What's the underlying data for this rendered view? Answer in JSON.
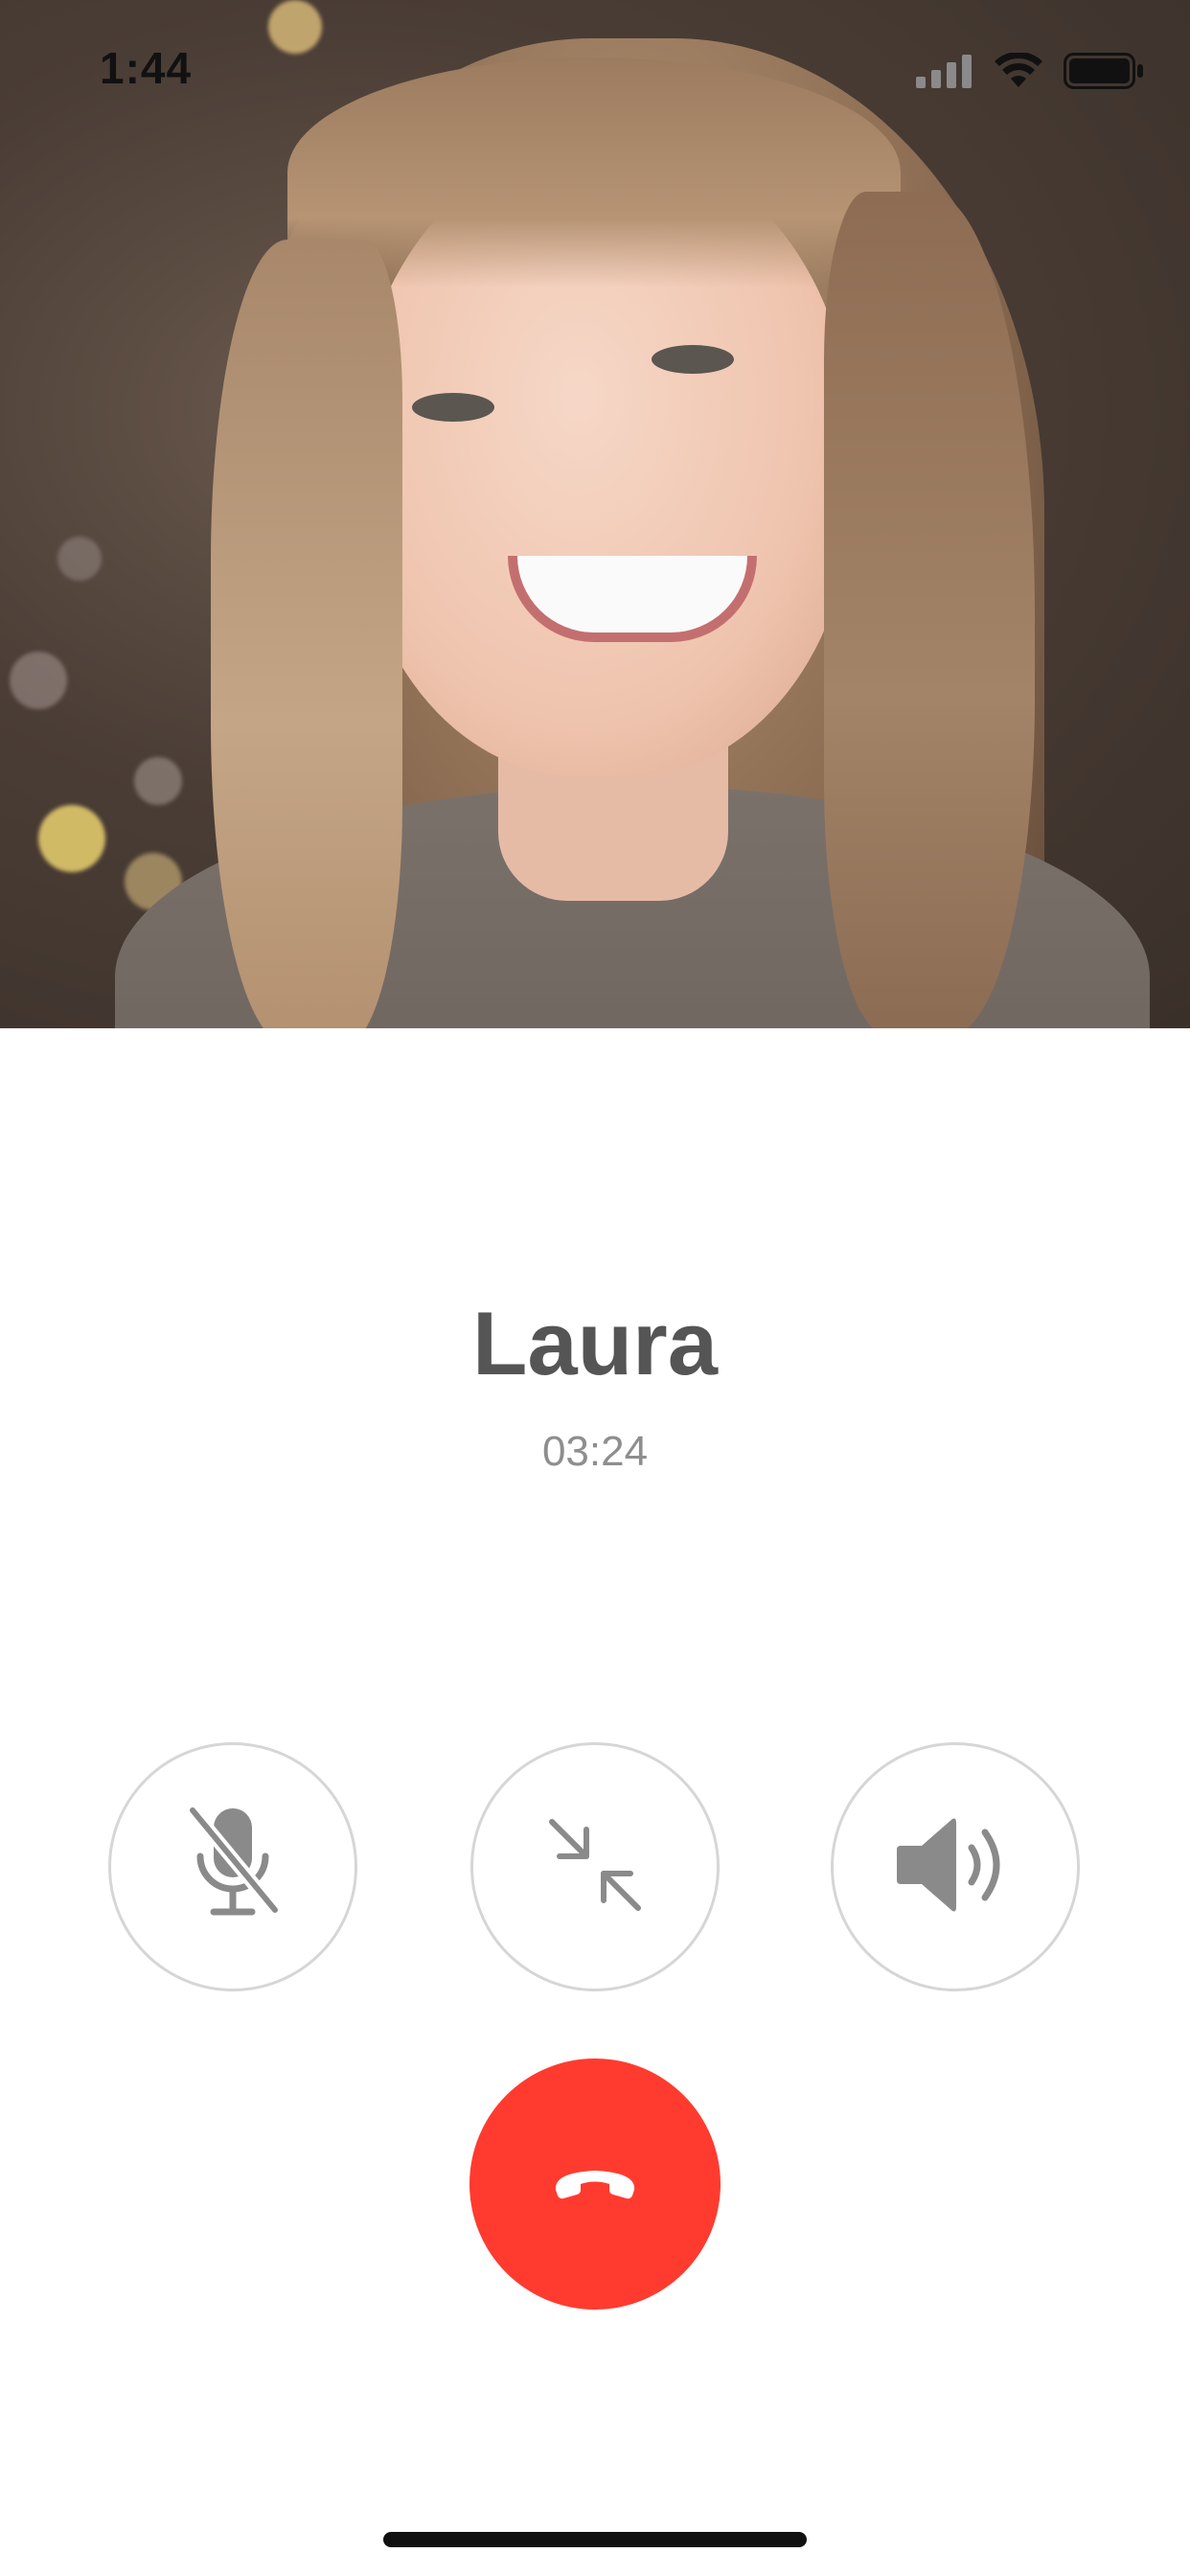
{
  "status_bar": {
    "time": "1:44",
    "icons": [
      "cellular-signal-icon",
      "wifi-icon",
      "battery-icon"
    ]
  },
  "video": {
    "description_icon": "remote-video-feed"
  },
  "caller": {
    "name": "Laura",
    "duration": "03:24"
  },
  "controls": {
    "mute": {
      "icon": "microphone-muted-icon"
    },
    "minimize": {
      "icon": "minimize-arrows-icon"
    },
    "speaker": {
      "icon": "speaker-icon"
    },
    "end_call": {
      "icon": "hang-up-phone-icon"
    }
  },
  "colors": {
    "end_call": "#ff3b2f",
    "control_border": "#d6d6d6",
    "control_icon": "#8a8a8a",
    "name_text": "#555555",
    "timer_text": "#8e8e8e"
  }
}
